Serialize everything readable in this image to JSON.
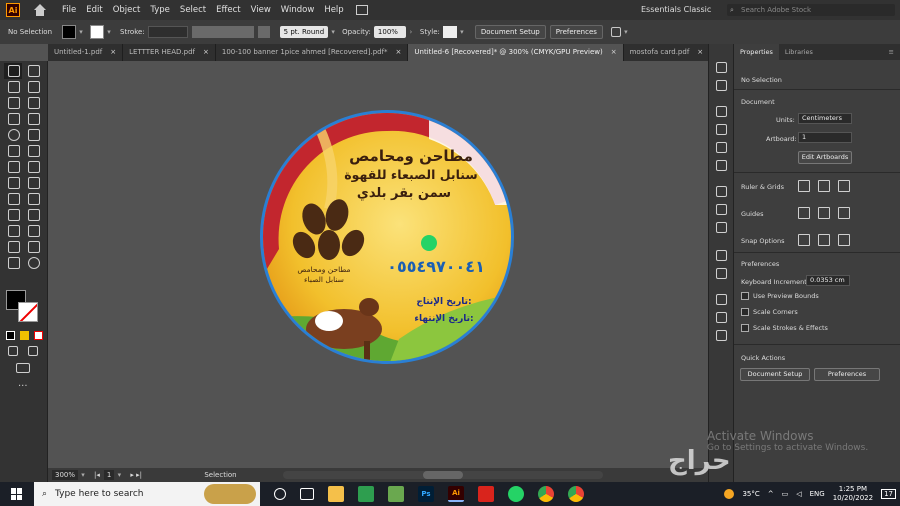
{
  "app": {
    "logo": "Ai"
  },
  "menubar": {
    "items": [
      "File",
      "Edit",
      "Object",
      "Type",
      "Select",
      "Effect",
      "View",
      "Window",
      "Help"
    ],
    "workspace": "Essentials Classic",
    "search_placeholder": "Search Adobe Stock"
  },
  "controlbar": {
    "selection": "No Selection",
    "stroke_label": "Stroke:",
    "brush": "5 pt. Round",
    "opacity_label": "Opacity:",
    "opacity": "100%",
    "style_label": "Style:",
    "document_setup": "Document Setup",
    "preferences": "Preferences"
  },
  "tabs": [
    {
      "label": "Untitled-1.pdf"
    },
    {
      "label": "LETTTER HEAD.pdf"
    },
    {
      "label": "100-100 banner 1pice ahmed [Recovered].pdf*"
    },
    {
      "label": "Untitled-6 [Recovered]* @ 300% (CMYK/GPU Preview)"
    },
    {
      "label": "mostofa card.pdf"
    }
  ],
  "artwork": {
    "line1": "مطاحن ومحامص",
    "line2": "سنابل الصبعاء للقهوة",
    "line3": "سمن بقر بلدي",
    "logo_text1": "مطاحن ومحامص",
    "logo_text2": "سنابل الصباء",
    "phone": "٠٥٥٤٩٧٠٠٤١",
    "prod_date": "تاريخ الإنتاج:",
    "exp_date": "تاريخ الإنتهاء:"
  },
  "statusbar": {
    "zoom": "300%",
    "artboard": "1",
    "tool": "Selection"
  },
  "panel": {
    "tabs": [
      "Properties",
      "Libraries"
    ],
    "no_selection": "No Selection",
    "document": "Document",
    "units_label": "Units:",
    "units": "Centimeters",
    "artboard_label": "Artboard:",
    "artboard": "1",
    "edit_artboards": "Edit Artboards",
    "rulers": "Ruler & Grids",
    "guides": "Guides",
    "snap": "Snap Options",
    "preferences": "Preferences",
    "keyboard_label": "Keyboard Increment:",
    "keyboard": "0.0353 cm",
    "preview_bounds": "Use Preview Bounds",
    "scale_corners": "Scale Corners",
    "scale_strokes": "Scale Strokes & Effects",
    "quick_actions": "Quick Actions",
    "qa_document_setup": "Document Setup",
    "qa_preferences": "Preferences"
  },
  "watermark": {
    "line1": "Activate Windows",
    "line2": "Go to Settings to activate Windows.",
    "brand": "حراج"
  },
  "taskbar": {
    "search_placeholder": "Type here to search",
    "weather": "35°C",
    "language": "ENG",
    "time": "1:25 PM",
    "date": "10/20/2022",
    "notif_count": "17",
    "apps": [
      "Ps",
      "Ai"
    ]
  }
}
